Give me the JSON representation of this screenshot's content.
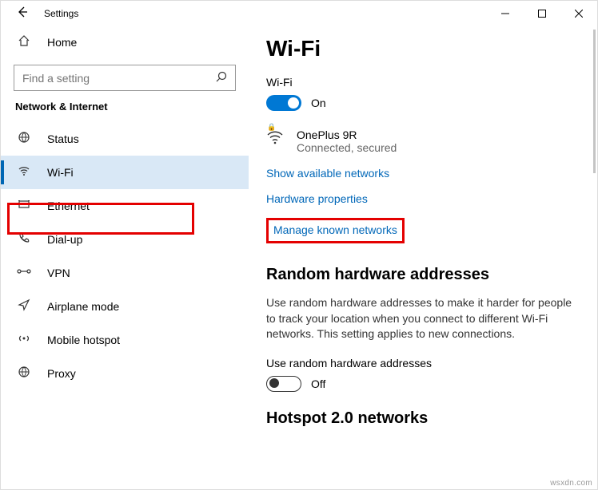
{
  "titlebar": {
    "title": "Settings"
  },
  "sidebar": {
    "home": "Home",
    "search_placeholder": "Find a setting",
    "category": "Network & Internet",
    "items": [
      {
        "label": "Status"
      },
      {
        "label": "Wi-Fi"
      },
      {
        "label": "Ethernet"
      },
      {
        "label": "Dial-up"
      },
      {
        "label": "VPN"
      },
      {
        "label": "Airplane mode"
      },
      {
        "label": "Mobile hotspot"
      },
      {
        "label": "Proxy"
      }
    ]
  },
  "main": {
    "page_title": "Wi-Fi",
    "wifi_label": "Wi-Fi",
    "wifi_state": "On",
    "network": {
      "name": "OnePlus 9R",
      "status": "Connected, secured"
    },
    "links": {
      "show_available": "Show available networks",
      "hw_props": "Hardware properties",
      "manage_known": "Manage known networks"
    },
    "random_head": "Random hardware addresses",
    "random_body": "Use random hardware addresses to make it harder for people to track your location when you connect to different Wi-Fi networks. This setting applies to new connections.",
    "random_toggle_label": "Use random hardware addresses",
    "random_toggle_state": "Off",
    "hotspot_head": "Hotspot 2.0 networks"
  },
  "watermark": "wsxdn.com"
}
